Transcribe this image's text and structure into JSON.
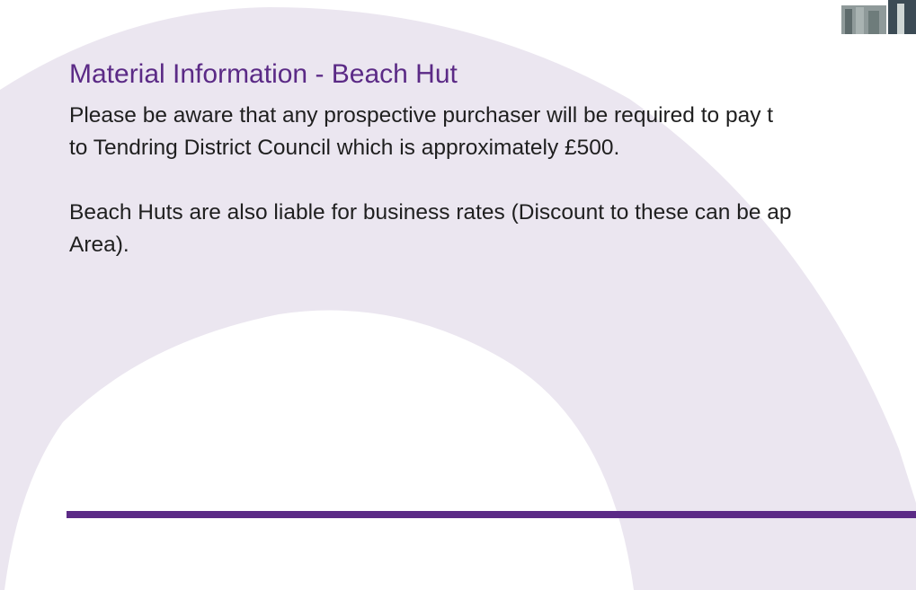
{
  "section": {
    "title": "Material Information - Beach Hut",
    "paragraphs": [
      {
        "line1": "Please be aware that any prospective purchaser will be required to pay t",
        "line2": "to Tendring District Council which is approximately £500."
      },
      {
        "line1": "Beach Huts are also liable for business rates (Discount to these can be ap",
        "line2": "Area)."
      }
    ]
  },
  "colors": {
    "accent": "#5b2a86",
    "background_shape": "#ebe6f0",
    "text": "#1f1f1f"
  }
}
